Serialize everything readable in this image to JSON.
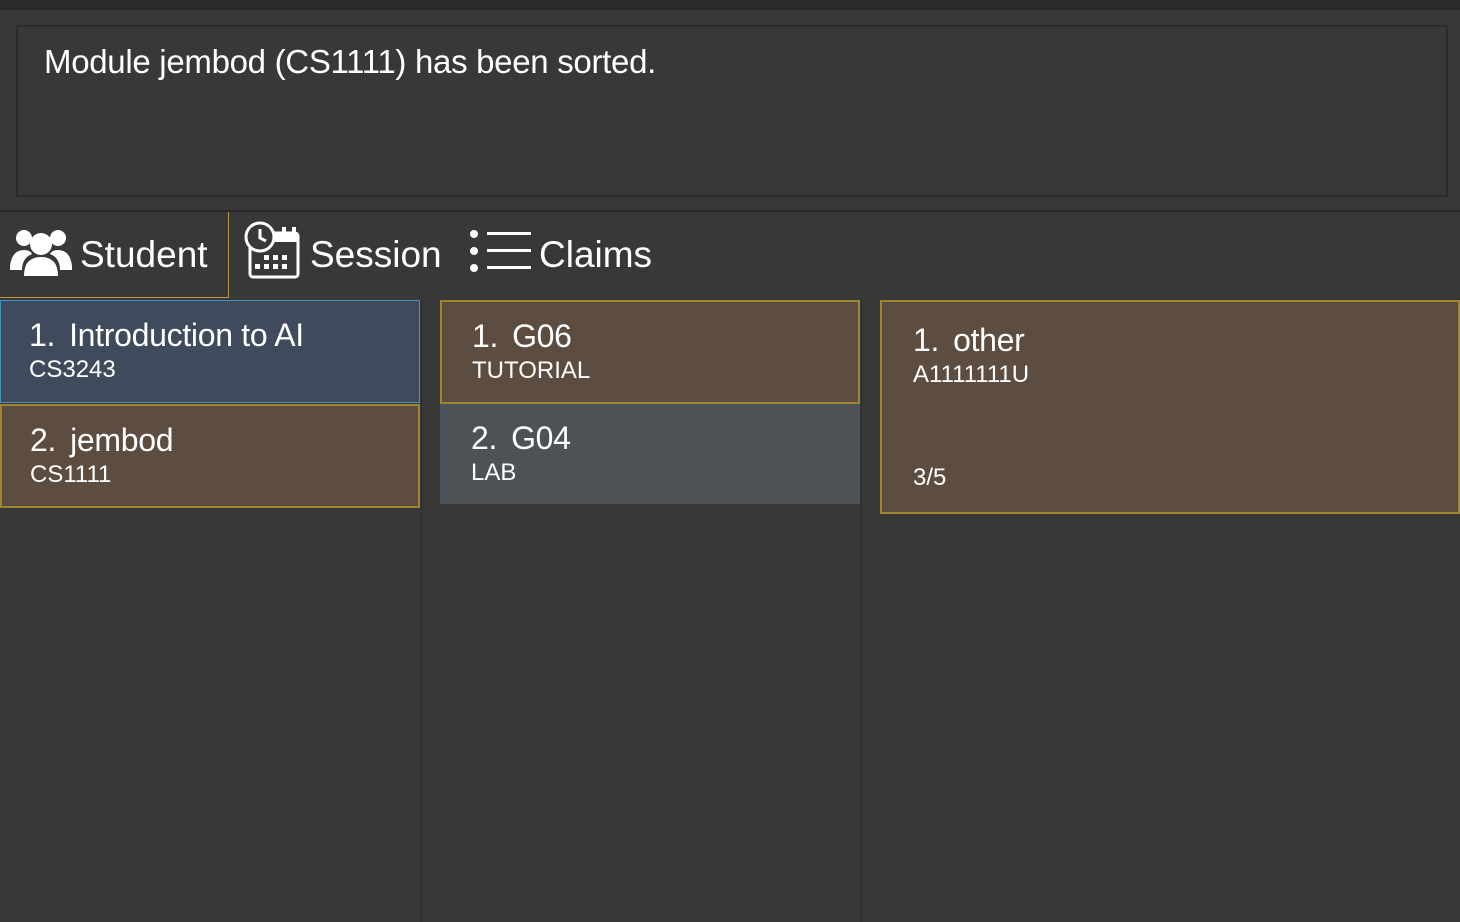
{
  "result_display": {
    "message": "Module jembod (CS1111) has been sorted."
  },
  "tabs": [
    {
      "label": "Student",
      "icon": "users-icon",
      "selected": true
    },
    {
      "label": "Session",
      "icon": "calendar-clock-icon",
      "selected": false
    },
    {
      "label": "Claims",
      "icon": "list-icon",
      "selected": false
    }
  ],
  "modules": [
    {
      "index": "1.",
      "name": "Introduction to AI",
      "code": "CS3243"
    },
    {
      "index": "2.",
      "name": "jembod",
      "code": "CS1111"
    }
  ],
  "sessions": [
    {
      "index": "1.",
      "name": "G06",
      "type": "TUTORIAL"
    },
    {
      "index": "2.",
      "name": "G04",
      "type": "LAB"
    }
  ],
  "claims": [
    {
      "index": "1.",
      "name": "other",
      "id": "A1111111U",
      "progress": "3/5"
    }
  ],
  "colors": {
    "background": "#383838",
    "selected_card": "#3f4a5d",
    "card_brown": "#5d4c40",
    "card_grey": "#4d5256",
    "accent_border": "#a08530",
    "selected_border": "#4a8fb8"
  }
}
